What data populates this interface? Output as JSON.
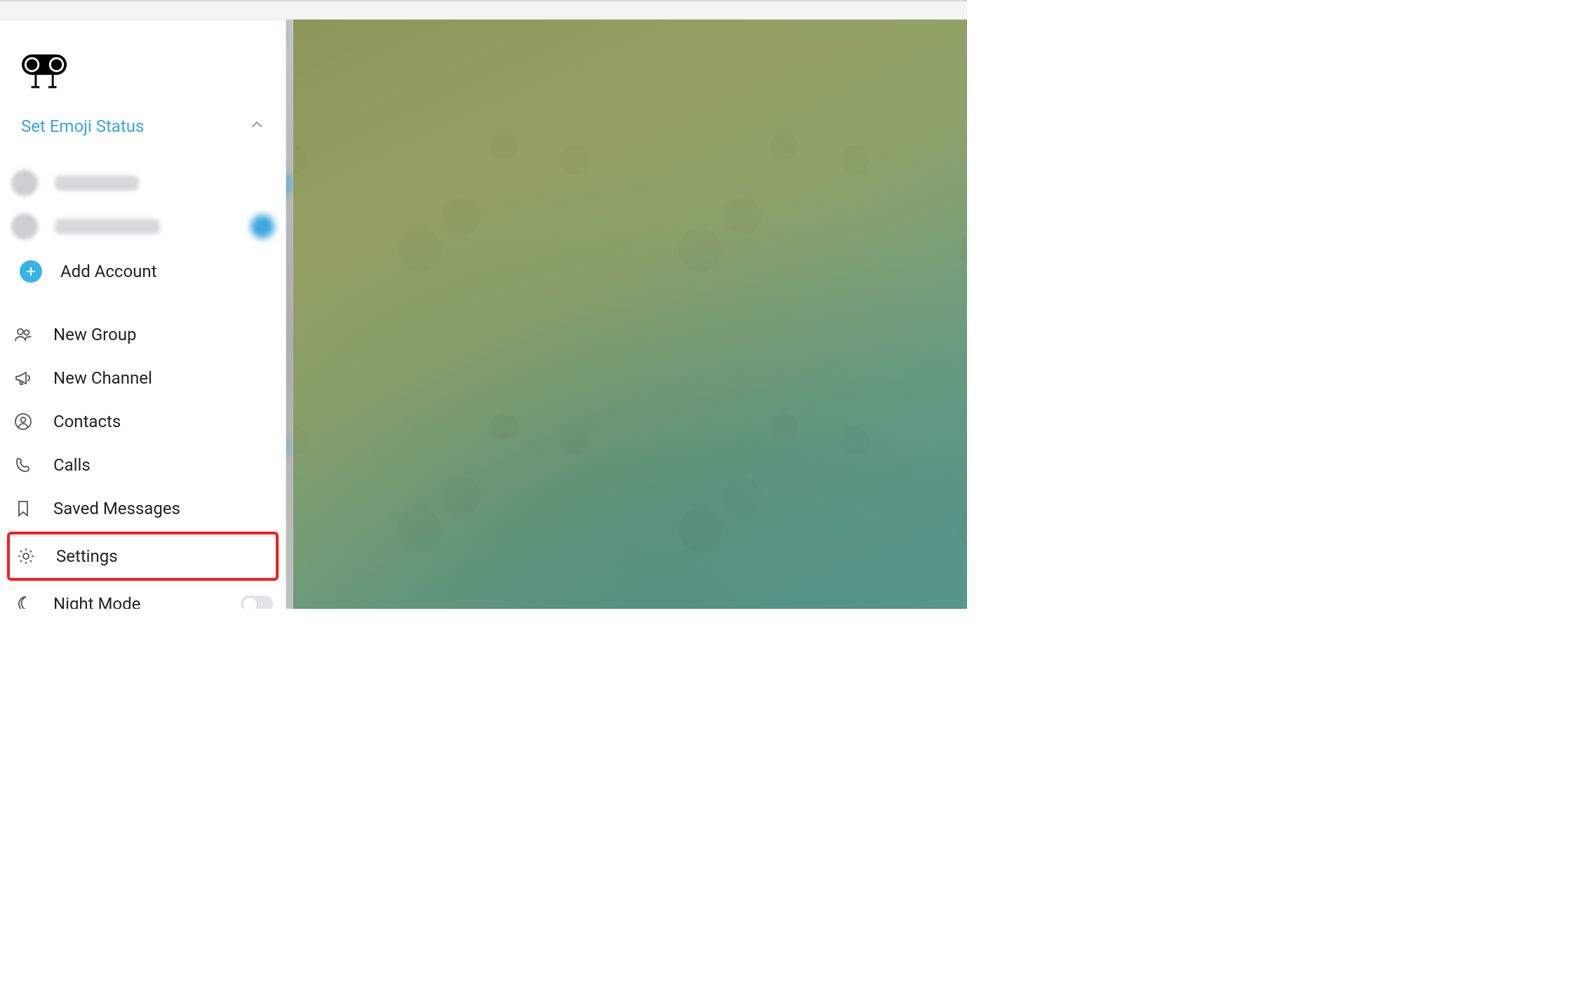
{
  "colors": {
    "accent": "#3aa4e0",
    "highlight": "#ff1a1a"
  },
  "drawer": {
    "emoji_status_label": "Set Emoji Status",
    "accounts": [
      {
        "name_redacted": true,
        "has_badge": false
      },
      {
        "name_redacted": true,
        "has_badge": true
      }
    ],
    "add_account_label": "Add Account",
    "menu": {
      "new_group": "New Group",
      "new_channel": "New Channel",
      "contacts": "Contacts",
      "calls": "Calls",
      "saved_messages": "Saved Messages",
      "settings": "Settings",
      "night_mode": "Night Mode"
    },
    "night_mode_on": false,
    "highlighted_item": "settings"
  }
}
